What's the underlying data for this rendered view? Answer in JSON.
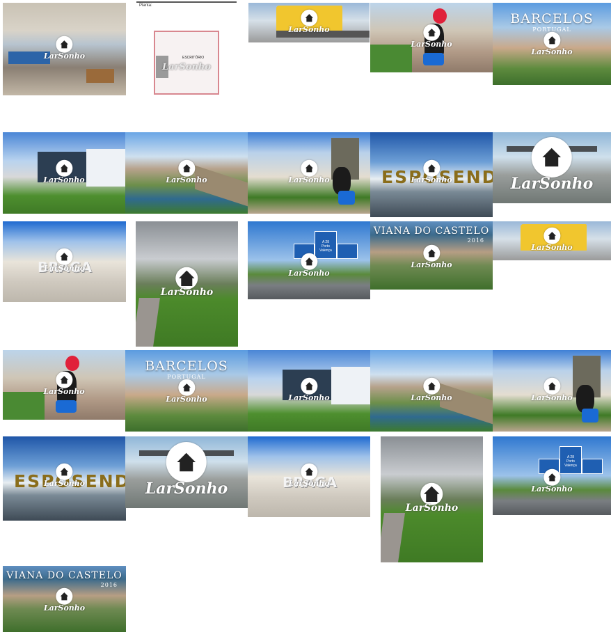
{
  "brand": {
    "watermark": "LarSonho"
  },
  "colors": {
    "background": "#ffffff",
    "sky": "#3d7fd0",
    "grass": "#4e8f2f",
    "floor_plan_wall": "#d8878f",
    "sign_gold": "#8a6d1b"
  },
  "gallery": {
    "thumbnails": [
      {
        "subject": "office interior"
      },
      {
        "subject": "floor plan",
        "caption": "Planta:",
        "room_label": "ESCRITÓRIO"
      },
      {
        "subject": "train at station"
      },
      {
        "subject": "Barcelos rooster statue"
      },
      {
        "subject": "Barcelos aerial",
        "title": "BARCELOS",
        "subtitle": "PORTUGAL"
      },
      {
        "subject": "stadium with rooster"
      },
      {
        "subject": "bridge over river"
      },
      {
        "subject": "town square with rooster"
      },
      {
        "subject": "Esposende sign",
        "sign_text": "ESPOSENDE"
      },
      {
        "subject": "toll plaza"
      },
      {
        "subject": "Braga sign",
        "sign_text": "BRAGA"
      },
      {
        "subject": "roundabout with sign"
      },
      {
        "subject": "motorway signs",
        "sign_route": "A 28",
        "sign_lines": [
          "Porto",
          "Valença"
        ]
      },
      {
        "subject": "Viana do Castelo aerial",
        "title": "VIANA DO CASTELO",
        "subtitle": "2016"
      },
      {
        "subject": "train at station"
      },
      {
        "subject": "Barcelos rooster statue"
      },
      {
        "subject": "Barcelos aerial",
        "title": "BARCELOS",
        "subtitle": "PORTUGAL"
      },
      {
        "subject": "stadium with rooster"
      },
      {
        "subject": "bridge over river"
      },
      {
        "subject": "town square with rooster"
      },
      {
        "subject": "Esposende sign",
        "sign_text": "ESPOSENDE"
      },
      {
        "subject": "toll plaza"
      },
      {
        "subject": "Braga sign",
        "sign_text": "BRAGA"
      },
      {
        "subject": "roundabout with sign"
      },
      {
        "subject": "motorway signs",
        "sign_route": "A 28",
        "sign_lines": [
          "Porto",
          "Valença"
        ]
      },
      {
        "subject": "Viana do Castelo aerial",
        "title": "VIANA DO CASTELO",
        "subtitle": "2016"
      }
    ]
  }
}
